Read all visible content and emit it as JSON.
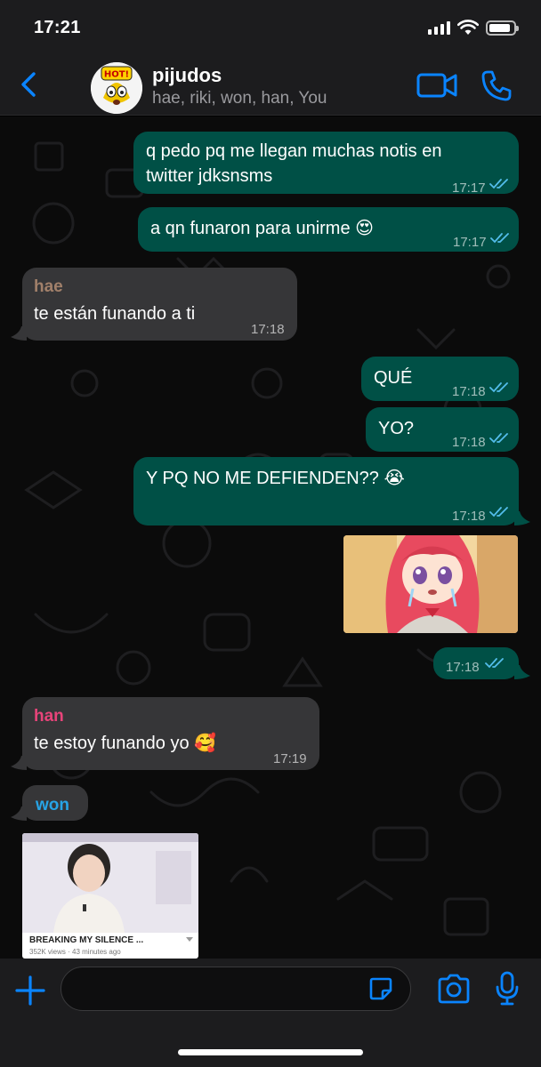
{
  "status_bar": {
    "time": "17:21",
    "battery_level": 0.88
  },
  "header": {
    "back_icon": "chevron-left-icon",
    "avatar_text": "HOT!",
    "title": "pijudos",
    "members": "hae, riki, won, han, You",
    "video_icon": "video-camera-icon",
    "call_icon": "phone-icon"
  },
  "messages": [
    {
      "direction": "out",
      "text_line1": "q pedo pq me llegan muchas notis en",
      "text_line2": "twitter jdksnsms",
      "time": "17:17",
      "status": "read"
    },
    {
      "direction": "out",
      "text": "a qn funaron para unirme 😍",
      "time": "17:17",
      "status": "read"
    },
    {
      "direction": "in",
      "sender": "hae",
      "text": "te están funando a ti",
      "time": "17:18"
    },
    {
      "direction": "out",
      "text": "QUÉ",
      "time": "17:18",
      "status": "read"
    },
    {
      "direction": "out",
      "text": "YO?",
      "time": "17:18",
      "status": "read"
    },
    {
      "direction": "out",
      "text": "Y PQ NO ME DEFIENDEN?? 😭",
      "time": "17:18",
      "status": "read"
    },
    {
      "direction": "out",
      "type": "image",
      "description_icon": "crying-anime-girl-image"
    },
    {
      "direction": "out",
      "type": "time-only",
      "time": "17:18",
      "status": "read"
    },
    {
      "direction": "in",
      "sender": "han",
      "text": "te estoy funando yo 🥰",
      "time": "17:19"
    },
    {
      "direction": "in",
      "sender": "won",
      "type": "sender-only"
    },
    {
      "direction": "in",
      "type": "video-thumbnail",
      "video_title": "BREAKING MY SILENCE ...",
      "video_meta": "352K views · 43 minutes ago"
    }
  ],
  "colors": {
    "outgoing_bubble": "#005046",
    "incoming_bubble": "#363638",
    "accent_blue": "#0a84ff",
    "read_tick": "#53bdeb",
    "sender_hae": "#a1806a",
    "sender_han": "#e8447a",
    "sender_won": "#27a4e6"
  },
  "input_bar": {
    "placeholder": "",
    "plus_icon": "plus-icon",
    "sticker_icon": "sticker-icon",
    "camera_icon": "camera-icon",
    "mic_icon": "microphone-icon"
  }
}
